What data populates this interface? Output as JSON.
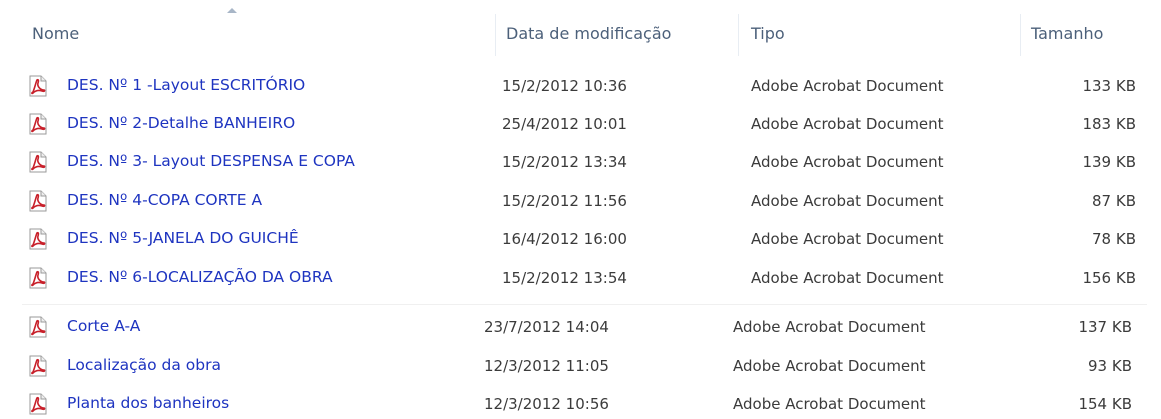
{
  "header": {
    "name_label": "Nome",
    "date_label": "Data de modificação",
    "type_label": "Tipo",
    "size_label": "Tamanho",
    "sort_icon": "sort-ascending-arrow"
  },
  "colors": {
    "file_name": "#1e34c0",
    "header_text": "#4c607a",
    "detail_text": "#3b3b3b",
    "pdf_icon": "#c8202a"
  },
  "files": [
    {
      "icon": "pdf-icon",
      "name": "DES. Nº 1 -Layout ESCRITÓRIO",
      "date": "15/2/2012 10:36",
      "type": "Adobe Acrobat Document",
      "size": "133 KB"
    },
    {
      "icon": "pdf-icon",
      "name": "DES. Nº 2-Detalhe BANHEIRO",
      "date": "25/4/2012 10:01",
      "type": "Adobe Acrobat Document",
      "size": "183 KB"
    },
    {
      "icon": "pdf-icon",
      "name": "DES. Nº 3- Layout DESPENSA E COPA",
      "date": "15/2/2012 13:34",
      "type": "Adobe Acrobat Document",
      "size": "139 KB"
    },
    {
      "icon": "pdf-icon",
      "name": "DES. Nº 4-COPA  CORTE A",
      "date": "15/2/2012 11:56",
      "type": "Adobe Acrobat Document",
      "size": "87 KB"
    },
    {
      "icon": "pdf-icon",
      "name": "DES. Nº 5-JANELA DO GUICHÊ",
      "date": "16/4/2012 16:00",
      "type": "Adobe Acrobat Document",
      "size": "78 KB"
    },
    {
      "icon": "pdf-icon",
      "name": "DES. Nº 6-LOCALIZAÇÃO DA OBRA",
      "date": "15/2/2012 13:54",
      "type": "Adobe Acrobat Document",
      "size": "156 KB"
    },
    {
      "icon": "pdf-icon",
      "name": "Corte A-A",
      "date": "23/7/2012 14:04",
      "type": "Adobe Acrobat Document",
      "size": "137 KB"
    },
    {
      "icon": "pdf-icon",
      "name": "Localização da obra",
      "date": "12/3/2012 11:05",
      "type": "Adobe Acrobat Document",
      "size": "93 KB"
    },
    {
      "icon": "pdf-icon",
      "name": "Planta dos banheiros",
      "date": "12/3/2012 10:56",
      "type": "Adobe Acrobat Document",
      "size": "154 KB"
    }
  ]
}
